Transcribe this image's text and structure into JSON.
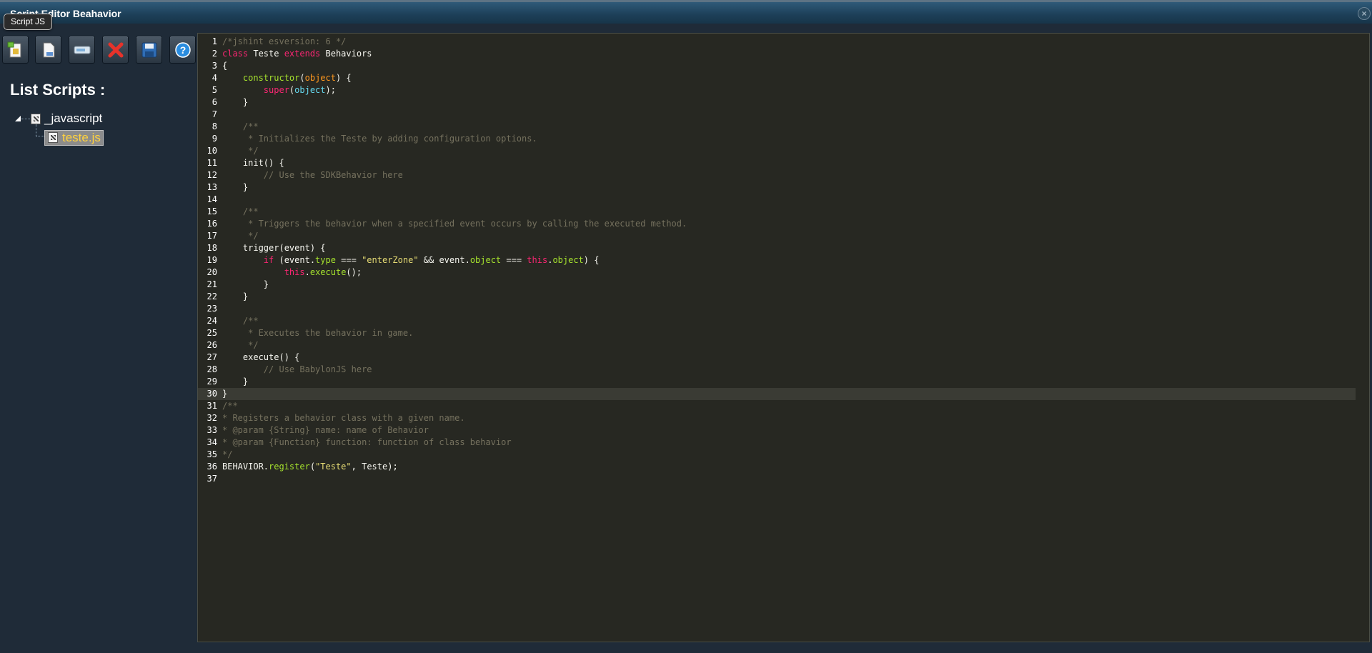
{
  "window": {
    "title": "Script Editor Beahavior",
    "tooltip": "Script JS"
  },
  "toolbar": {
    "buttons": [
      {
        "name": "new-script",
        "icon": "new-script-icon"
      },
      {
        "name": "new-file",
        "icon": "new-file-icon"
      },
      {
        "name": "rename",
        "icon": "rename-icon"
      },
      {
        "name": "delete",
        "icon": "delete-icon",
        "color": "#e8322a"
      },
      {
        "name": "save",
        "icon": "save-icon"
      },
      {
        "name": "help",
        "icon": "help-icon",
        "color": "#2a8de0"
      }
    ]
  },
  "sidebar": {
    "title": "List Scripts :",
    "tree": {
      "folder": "_javascript",
      "files": [
        "teste.js"
      ],
      "selected": "teste.js"
    }
  },
  "colors": {
    "keyword": "#f92672",
    "function": "#a6e22e",
    "param": "#fd971f",
    "string": "#e6db74",
    "comment": "#75715e",
    "builtin": "#66d9ef",
    "background": "#272822"
  },
  "editor": {
    "active_line": 30,
    "lines": [
      {
        "n": "1",
        "t": [
          [
            "c",
            "/*jshint esversion: 6 */"
          ]
        ]
      },
      {
        "n": "2",
        "t": [
          [
            "k",
            "class"
          ],
          [
            "",
            " Teste "
          ],
          [
            "k",
            "extends"
          ],
          [
            "",
            " Behaviors"
          ]
        ]
      },
      {
        "n": "3",
        "t": [
          [
            "",
            "{"
          ]
        ]
      },
      {
        "n": "4",
        "t": [
          [
            "",
            "    "
          ],
          [
            "f",
            "constructor"
          ],
          [
            "",
            "("
          ],
          [
            "o",
            "object"
          ],
          [
            "",
            ") {"
          ]
        ]
      },
      {
        "n": "5",
        "t": [
          [
            "",
            "        "
          ],
          [
            "k",
            "super"
          ],
          [
            "",
            "("
          ],
          [
            "t",
            "object"
          ],
          [
            "",
            ");"
          ]
        ]
      },
      {
        "n": "6",
        "t": [
          [
            "",
            "    }"
          ]
        ]
      },
      {
        "n": "7",
        "t": []
      },
      {
        "n": "8",
        "t": [
          [
            "c",
            "    /**"
          ]
        ]
      },
      {
        "n": "9",
        "t": [
          [
            "c",
            "     * Initializes the Teste by adding configuration options."
          ]
        ]
      },
      {
        "n": "10",
        "t": [
          [
            "c",
            "     */"
          ]
        ]
      },
      {
        "n": "11",
        "t": [
          [
            "",
            "    init() {"
          ]
        ]
      },
      {
        "n": "12",
        "t": [
          [
            "c",
            "        // Use the SDKBehavior here"
          ]
        ]
      },
      {
        "n": "13",
        "t": [
          [
            "",
            "    }"
          ]
        ]
      },
      {
        "n": "14",
        "t": []
      },
      {
        "n": "15",
        "t": [
          [
            "c",
            "    /**"
          ]
        ]
      },
      {
        "n": "16",
        "t": [
          [
            "c",
            "     * Triggers the behavior when a specified event occurs by calling the executed method."
          ]
        ]
      },
      {
        "n": "17",
        "t": [
          [
            "c",
            "     */"
          ]
        ]
      },
      {
        "n": "18",
        "t": [
          [
            "",
            "    trigger(event) {"
          ]
        ]
      },
      {
        "n": "19",
        "t": [
          [
            "",
            "        "
          ],
          [
            "k",
            "if"
          ],
          [
            "",
            " (event."
          ],
          [
            "f",
            "type"
          ],
          [
            "",
            " === "
          ],
          [
            "s",
            "\"enterZone\""
          ],
          [
            "",
            " && event."
          ],
          [
            "f",
            "object"
          ],
          [
            "",
            " === "
          ],
          [
            "k",
            "this"
          ],
          [
            "",
            "."
          ],
          [
            "f",
            "object"
          ],
          [
            "",
            ") {"
          ]
        ]
      },
      {
        "n": "20",
        "t": [
          [
            "",
            "            "
          ],
          [
            "k",
            "this"
          ],
          [
            "",
            "."
          ],
          [
            "f",
            "execute"
          ],
          [
            "",
            "();"
          ]
        ]
      },
      {
        "n": "21",
        "t": [
          [
            "",
            "        }"
          ]
        ]
      },
      {
        "n": "22",
        "t": [
          [
            "",
            "    }"
          ]
        ]
      },
      {
        "n": "23",
        "t": []
      },
      {
        "n": "24",
        "t": [
          [
            "c",
            "    /**"
          ]
        ]
      },
      {
        "n": "25",
        "t": [
          [
            "c",
            "     * Executes the behavior in game."
          ]
        ]
      },
      {
        "n": "26",
        "t": [
          [
            "c",
            "     */"
          ]
        ]
      },
      {
        "n": "27",
        "t": [
          [
            "",
            "    execute() {"
          ]
        ]
      },
      {
        "n": "28",
        "t": [
          [
            "c",
            "        // Use BabylonJS here"
          ]
        ]
      },
      {
        "n": "29",
        "t": [
          [
            "",
            "    }"
          ]
        ]
      },
      {
        "n": "30",
        "t": [
          [
            "",
            "}"
          ]
        ]
      },
      {
        "n": "31",
        "t": [
          [
            "c",
            "/**"
          ]
        ]
      },
      {
        "n": "32",
        "t": [
          [
            "c",
            "* Registers a behavior class with a given name."
          ]
        ]
      },
      {
        "n": "33",
        "t": [
          [
            "c",
            "* @param {String} name: name of Behavior"
          ]
        ]
      },
      {
        "n": "34",
        "t": [
          [
            "c",
            "* @param {Function} function: function of class behavior"
          ]
        ]
      },
      {
        "n": "35",
        "t": [
          [
            "c",
            "*/"
          ]
        ]
      },
      {
        "n": "36",
        "t": [
          [
            "",
            "BEHAVIOR."
          ],
          [
            "f",
            "register"
          ],
          [
            "",
            "("
          ],
          [
            "s",
            "\"Teste\""
          ],
          [
            "",
            ", Teste);"
          ]
        ]
      },
      {
        "n": "37",
        "t": []
      }
    ]
  }
}
